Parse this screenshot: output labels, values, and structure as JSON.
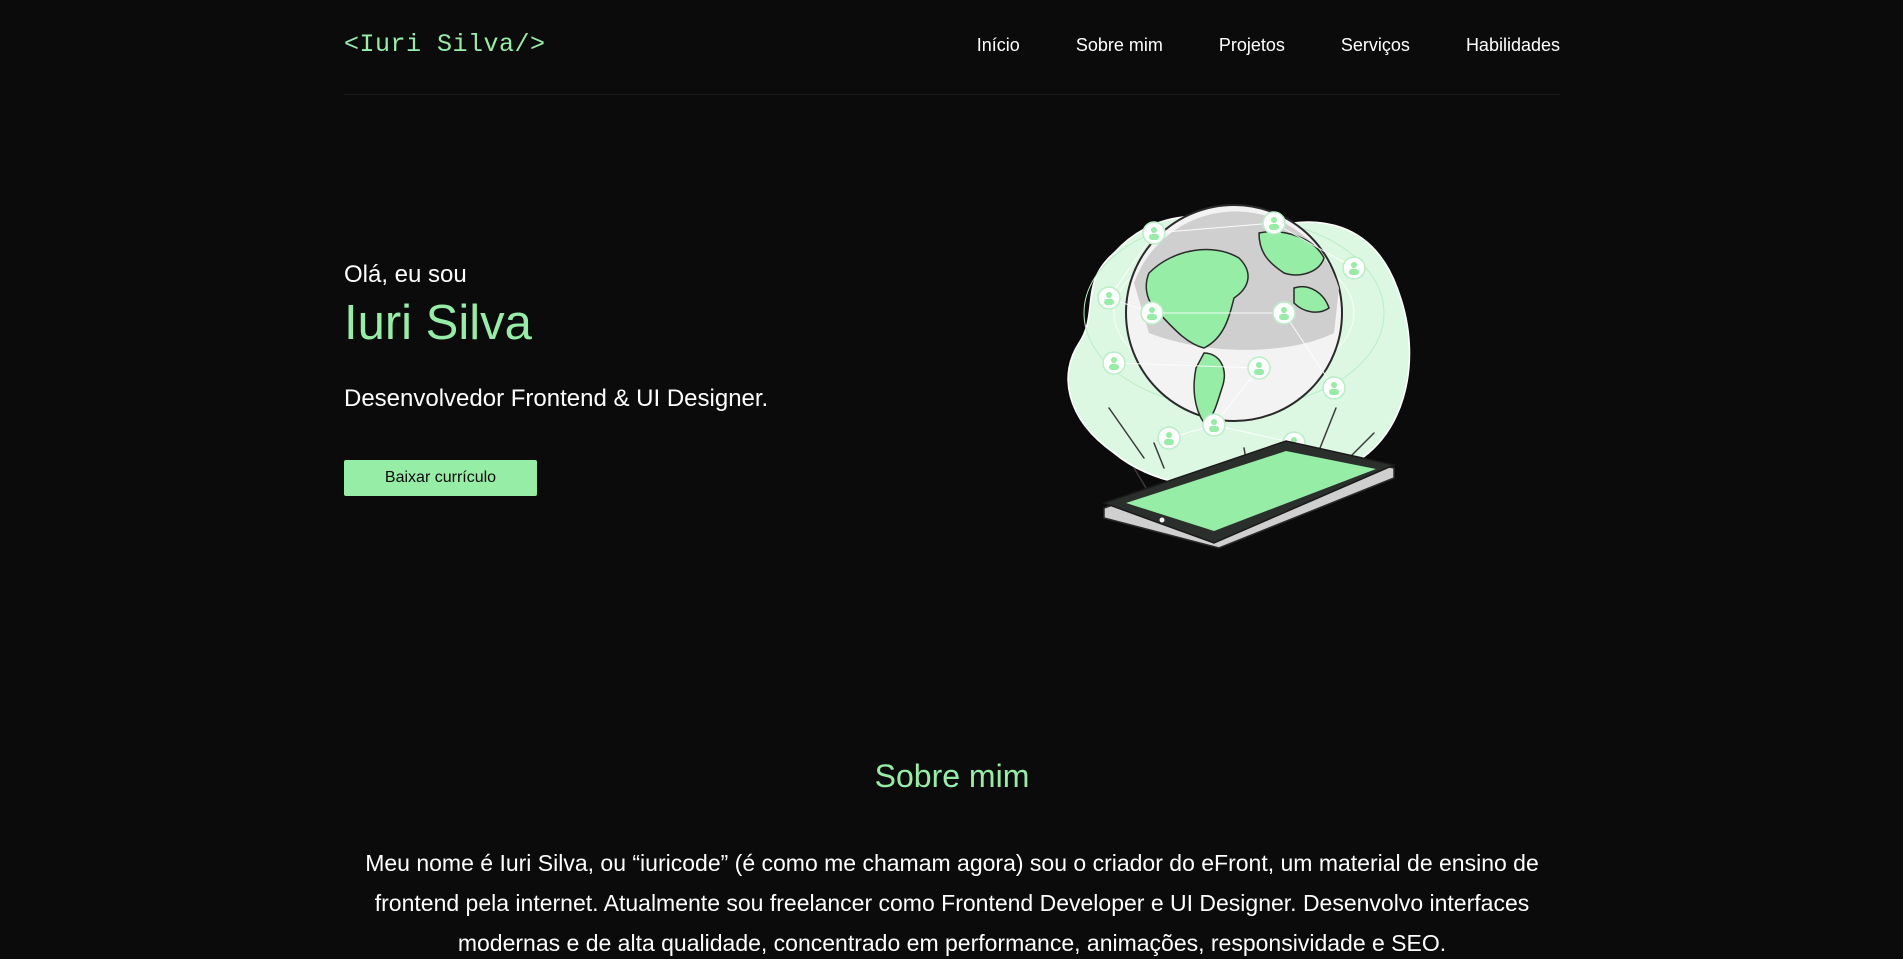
{
  "header": {
    "logo": "<Iuri Silva/>",
    "nav": [
      "Início",
      "Sobre mim",
      "Projetos",
      "Serviços",
      "Habilidades"
    ]
  },
  "hero": {
    "greeting": "Olá, eu sou",
    "name": "Iuri Silva",
    "role": "Desenvolvedor Frontend & UI Designer.",
    "cta_label": "Baixar currículo",
    "illustration_icon": "globe-tablet-network-illustration"
  },
  "about": {
    "title": "Sobre mim",
    "text": "Meu nome é Iuri Silva, ou “iuricode” (é como me chamam agora) sou o criador do eFront, um material de ensino de frontend pela internet. Atualmente sou freelancer como Frontend Developer e UI Designer. Desenvolvo interfaces modernas e de alta qualidade, concentrado em performance, animações, responsividade e SEO."
  },
  "colors": {
    "background": "#0b0b0b",
    "accent": "#95eda6",
    "text": "#ffffff"
  }
}
